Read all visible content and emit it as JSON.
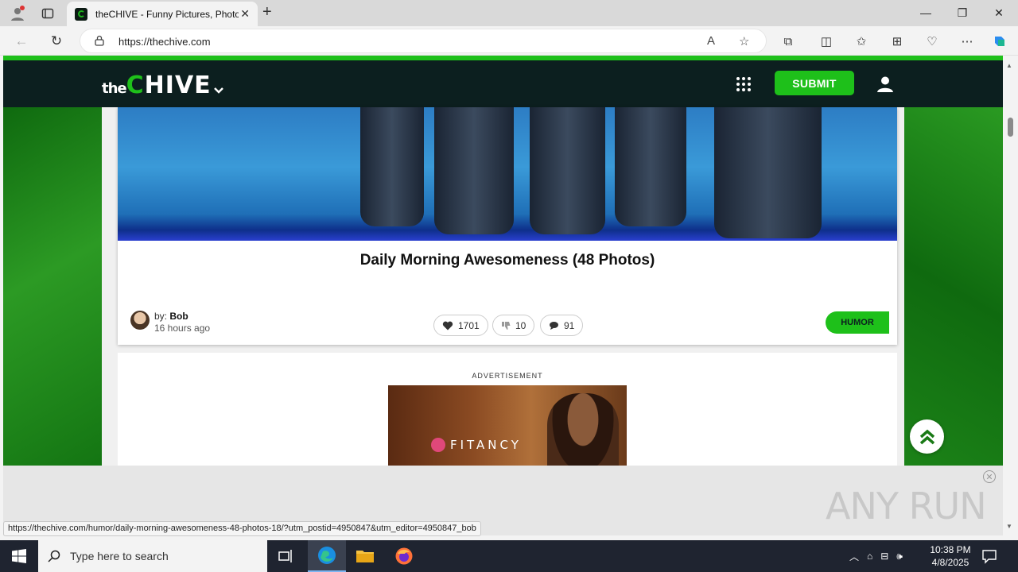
{
  "browser": {
    "tab_title": "theCHIVE - Funny Pictures, Photos",
    "url": "https://thechive.com",
    "status_url": "https://thechive.com/humor/daily-morning-awesomeness-48-photos-18/?utm_postid=4950847&utm_editor=4950847_bob"
  },
  "site": {
    "logo_the": "the",
    "logo_chive_c": "C",
    "logo_chive_rest": "HIVE",
    "submit_label": "SUBMIT"
  },
  "post": {
    "title": "Daily Morning Awesomeness (48 Photos)",
    "by_prefix": "by:",
    "author": "Bob",
    "time_ago": "16 hours ago",
    "likes": "1701",
    "dislikes": "10",
    "comments": "91",
    "category": "HUMOR"
  },
  "ad": {
    "label": "ADVERTISEMENT",
    "brand": "FITANCY"
  },
  "watermark": "ANY RUN",
  "taskbar": {
    "search_placeholder": "Type here to search",
    "time": "10:38 PM",
    "date": "4/8/2025"
  },
  "colors": {
    "chive_green": "#1ec01a",
    "header_dark": "#0c1f1f"
  }
}
